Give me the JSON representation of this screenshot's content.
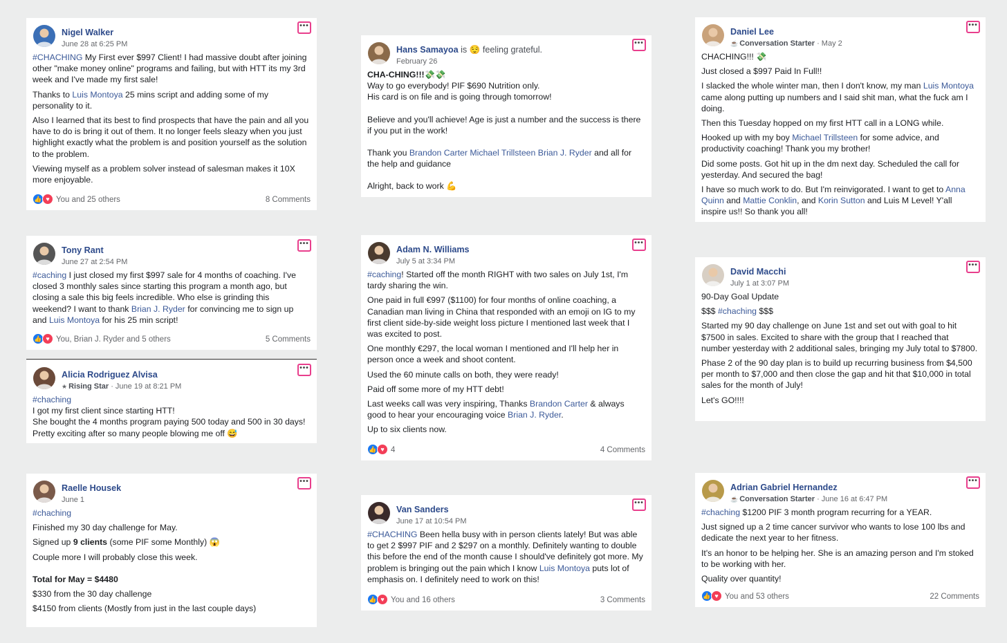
{
  "posts": [
    {
      "author": "Nigel Walker",
      "date": "June 28 at 6:25 PM",
      "avatar_color": "#3b6fb6",
      "body": [
        "<span class='lk'>#CHACHING</span> My First ever $997 Client! I had massive doubt after joining other \"make money online\" programs and failing, but with HTT its my 3rd week and I've made my first sale!",
        "Thanks to <span class='lk'>Luis Montoya</span> 25 mins script and adding some of my personality to it.",
        "Also I learned that its best to find prospects that have the pain and all you have to do is bring it out of them. It no longer feels sleazy when you just highlight exactly what the problem is and position yourself as the solution to the problem.",
        "Viewing myself as a problem solver instead of salesman makes it 10X more enjoyable."
      ],
      "reactions": "You and 25 others",
      "comments": "8 Comments"
    },
    {
      "author": "Hans Samayoa",
      "feeling": "is 😌 feeling grateful.",
      "date": "February 26",
      "avatar_color": "#8a6a4a",
      "body": [
        "<b>CHA-CHING!!!💸💸</b><br>Way to go everybody! PIF $690 Nutrition only.<br>His card is on file and is going through tomorrow!",
        "",
        "Believe and you'll achieve! Age is just a number and the success is there if you put in the work!",
        "",
        "Thank you <span class='lk'>Brandon Carter</span> <span class='lk'>Michael Trillsteen</span> <span class='lk'>Brian J. Ryder</span> and all for the help and guidance",
        "",
        "Alright, back to work 💪"
      ]
    },
    {
      "author": "Daniel Lee",
      "badge": "Conversation Starter",
      "badge_icon": "☕",
      "date": " · May 2",
      "avatar_color": "#c9a27a",
      "body": [
        "CHACHING!!! 💸",
        "Just closed a $997 Paid In Full!!",
        "I slacked the whole winter man, then I don't know, my man <span class='lk'>Luis Montoya</span> came along putting up numbers and I said shit man, what the fuck am I doing.",
        "Then this Tuesday hopped on my first HTT call in a LONG while.",
        "Hooked up with my boy <span class='lk'>Michael Trillsteen</span> for some advice, and productivity coaching! Thank you my brother!",
        "Did some posts. Got hit up in the dm next day. Scheduled the call for yesterday. And secured the bag!",
        "I have so much work to do. But I'm reinvigorated. I want to get to <span class='lk'>Anna Quinn</span> and <span class='lk'>Mattie Conklin</span>, and <span class='lk'>Korin Sutton</span> and Luis M Level! Y'all inspire us!! So thank you all!"
      ]
    },
    {
      "author": "Tony Rant",
      "date": "June 27 at 2:54 PM",
      "avatar_color": "#555555",
      "body": [
        "<span class='lk'>#caching</span> I just closed my first $997 sale for 4 months of coaching. I've closed 3 monthly sales since starting this program a month ago, but closing a sale this big feels incredible. Who else is grinding this weekend? I want to thank <span class='lk'>Brian J. Ryder</span> for convincing me to sign up and <span class='lk'>Luis Montoya</span> for his 25 min script!"
      ],
      "reactions": "You, Brian J. Ryder and 5 others",
      "comments": "5 Comments"
    },
    {
      "author": "Adam N. Williams",
      "date": "July 5 at 3:34 PM",
      "avatar_color": "#4a3a2e",
      "body": [
        "<span class='lk'>#caching</span>! Started off the month RIGHT with two sales on July 1st, I'm tardy sharing the win.",
        "One paid in full €997 ($1100) for four months of online coaching, a Canadian man living in China that responded with an emoji on IG to my first client side-by-side weight loss picture I mentioned last week that I was excited to post.",
        "One monthly €297, the local woman I mentioned and I'll help her in person once a week and shoot content.",
        "Used the 60 minute calls on both, they were ready!",
        "Paid off some more of my HTT debt!",
        "Last weeks call was very inspiring, Thanks <span class='lk'>Brandon Carter</span> &amp; always good to hear your encouraging voice <span class='lk'>Brian J. Ryder</span>.",
        "Up to six clients now."
      ],
      "reactions": "4",
      "comments": "4 Comments"
    },
    {
      "author": "David Macchi",
      "date": "July 1 at 3:07 PM",
      "avatar_color": "#d8cfc4",
      "body": [
        "90-Day Goal Update",
        "$$$ <span class='lk'>#chaching</span> $$$",
        "Started my 90 day challenge on June 1st and set out with goal to hit $7500 in sales. Excited to share with the group that I reached that number yesterday with 2 additional sales, bringing my July total to $7800.",
        "Phase 2 of the 90 day plan is to build up recurring business from $4,500 per month to $7,000 and then close the gap and hit that $10,000 in total sales for the month of July!",
        "Let's GO!!!!"
      ]
    },
    {
      "author": "Alicia Rodriguez Alvisa",
      "badge": "Rising Star",
      "badge_icon": "★",
      "date": " · June 19 at 8:21 PM",
      "avatar_color": "#6b4a3a",
      "body": [
        "<span class='lk'>#chaching</span><br>I got my first client since starting HTT!<br>She bought the 4 months program paying 500 today and 500 in 30 days!<br>Pretty exciting after so many people blowing me off 😅"
      ]
    },
    {
      "author": "Raelle Housek",
      "date": "June 1",
      "avatar_color": "#7a5a4a",
      "body": [
        "<span class='lk'>#chaching</span>",
        "Finished my 30 day challenge for May.",
        "Signed up <b>9 clients</b> (some PIF some Monthly) 😱",
        "Couple more I will probably close this week.",
        "",
        "<b>Total for May = $4480</b>",
        "$330 from the 30 day challenge",
        "$4150 from clients (Mostly from just in the last couple days)"
      ]
    },
    {
      "author": "Van Sanders",
      "date": "June 17 at 10:54 PM",
      "avatar_color": "#3a2a2a",
      "body": [
        "<span class='lk'>#CHACHING</span> Been hella busy with in person clients lately! But was able to get 2 $997 PIF and 2 $297 on a monthly. Definitely wanting to double this before the end of the month cause I should've definitely got more. My problem is bringing out the pain which I know <span class='lk'>Luis Montoya</span> puts lot of emphasis on. I definitely need to work on this!"
      ],
      "reactions": "You and 16 others",
      "comments": "3 Comments"
    },
    {
      "author": "Adrian Gabriel Hernandez",
      "badge": "Conversation Starter",
      "badge_icon": "☕",
      "date": " · June 16 at 6:47 PM",
      "avatar_color": "#b89a4a",
      "body": [
        "<span class='lk'>#chaching</span> $1200 PIF 3 month program recurring for a YEAR.",
        "Just signed up a 2 time cancer survivor who wants to lose 100 lbs and dedicate the next year to her fitness.",
        "It's an honor to be helping her. She is an amazing person and I'm stoked to be working with her.",
        "Quality over quantity!"
      ],
      "reactions": "You and 53 others",
      "comments": "22 Comments"
    }
  ],
  "icons": {
    "more": "more-options-icon",
    "like": "like-reaction-icon",
    "love": "love-reaction-icon"
  },
  "colors": {
    "link": "#3b5998",
    "more_border": "#e83e8c"
  }
}
